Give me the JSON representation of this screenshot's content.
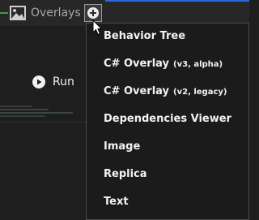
{
  "toolbar": {
    "overlays_label": "Overlays",
    "add_icon": "plus-circle-icon"
  },
  "panel": {
    "run_label": "Run"
  },
  "menu": {
    "items": [
      {
        "label": "Behavior Tree",
        "sub": ""
      },
      {
        "label": "C# Overlay",
        "sub": "(v3, alpha)"
      },
      {
        "label": "C# Overlay",
        "sub": "(v2, legacy)"
      },
      {
        "label": "Dependencies Viewer",
        "sub": ""
      },
      {
        "label": "Image",
        "sub": ""
      },
      {
        "label": "Replica",
        "sub": ""
      },
      {
        "label": "Text",
        "sub": ""
      }
    ]
  },
  "colors": {
    "background": "#1e1e1e",
    "menu_background": "#1b1b1b",
    "accent_blue": "#2a6ad8",
    "accent_green": "#3e9e3e"
  }
}
